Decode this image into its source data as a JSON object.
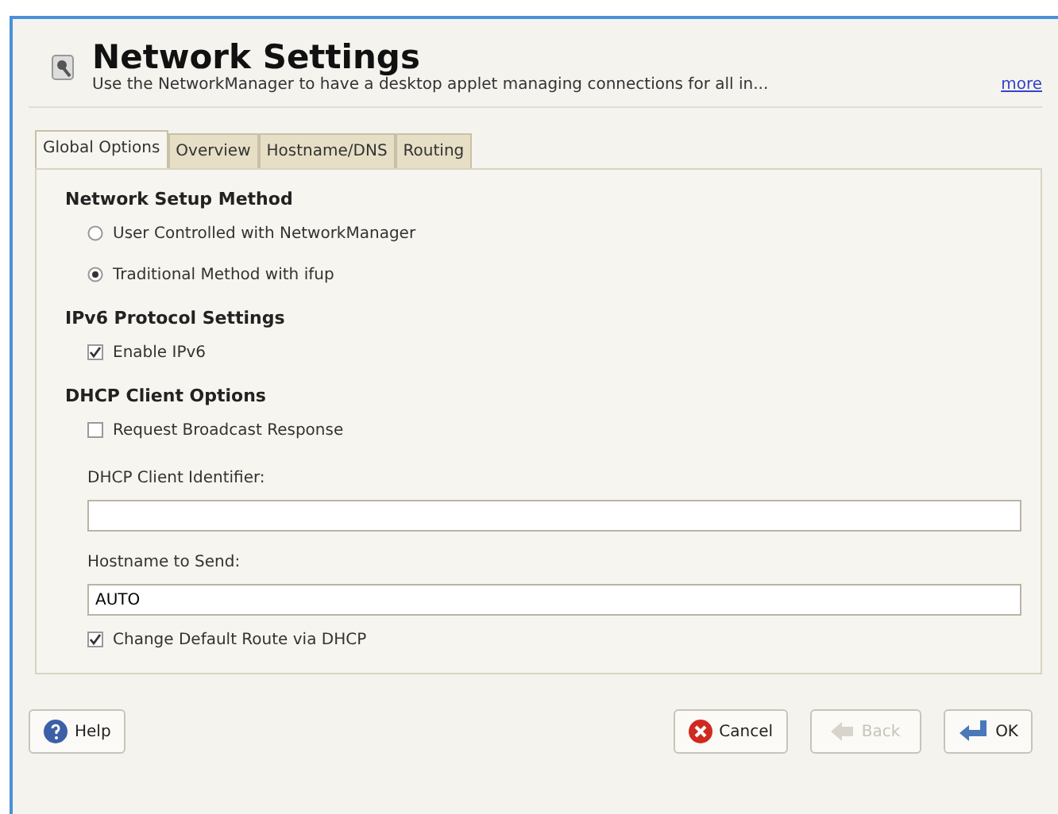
{
  "header": {
    "title": "Network Settings",
    "description": "Use the NetworkManager to have a desktop applet managing connections for all in...",
    "more_link": "more"
  },
  "tabs": [
    {
      "label": "Global Options",
      "selected": true
    },
    {
      "label": "Overview",
      "selected": false
    },
    {
      "label": "Hostname/DNS",
      "selected": false
    },
    {
      "label": "Routing",
      "selected": false
    }
  ],
  "sections": [
    {
      "title": "Network Setup Method",
      "items": [
        {
          "kind": "radio",
          "label": "User Controlled with NetworkManager",
          "selected": false
        },
        {
          "kind": "radio",
          "label": "Traditional Method with ifup",
          "selected": true
        }
      ]
    },
    {
      "title": "IPv6 Protocol Settings",
      "items": [
        {
          "kind": "checkbox",
          "label": "Enable IPv6",
          "checked": true
        }
      ]
    },
    {
      "title": "DHCP Client Options",
      "items": [
        {
          "kind": "checkbox",
          "label": "Request Broadcast Response",
          "checked": false
        },
        {
          "kind": "field",
          "label": "DHCP Client Identifier:",
          "value": ""
        },
        {
          "kind": "field",
          "label": "Hostname to Send:",
          "value": "AUTO"
        },
        {
          "kind": "checkbox",
          "label": "Change Default Route via DHCP",
          "checked": true
        }
      ]
    }
  ],
  "buttons": [
    {
      "kind": "help",
      "label": "Help",
      "disabled": false
    },
    {
      "kind": "cancel",
      "label": "Cancel",
      "disabled": false
    },
    {
      "kind": "back",
      "label": "Back",
      "disabled": true
    },
    {
      "kind": "ok",
      "label": "OK",
      "disabled": false
    }
  ]
}
